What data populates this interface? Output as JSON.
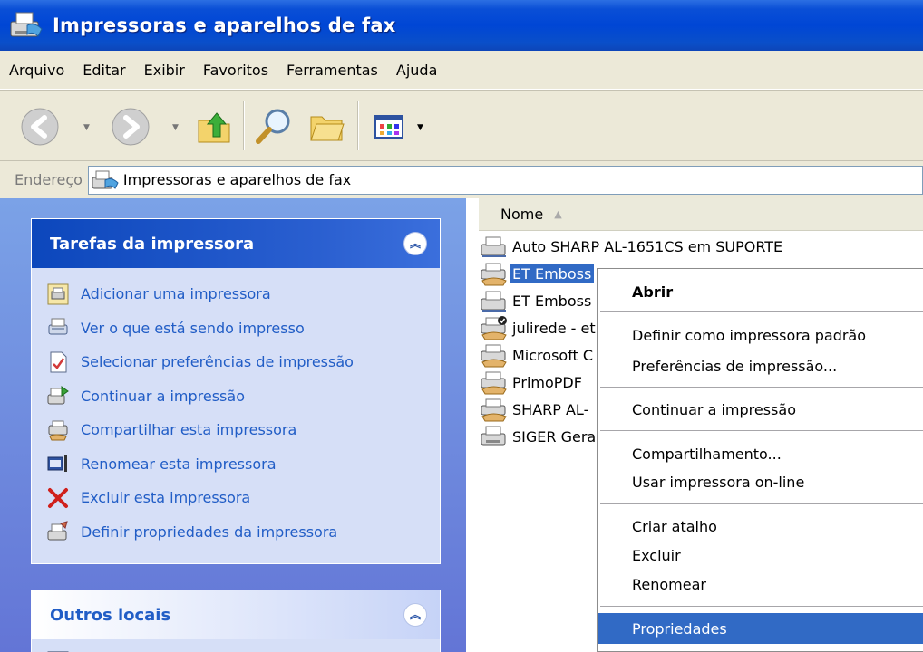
{
  "window": {
    "title": "Impressoras e aparelhos de fax"
  },
  "menu": [
    "Arquivo",
    "Editar",
    "Exibir",
    "Favoritos",
    "Ferramentas",
    "Ajuda"
  ],
  "address": {
    "label": "Endereço",
    "value": "Impressoras e aparelhos de fax"
  },
  "tasks_panel": {
    "title": "Tarefas da impressora",
    "items": [
      "Adicionar uma impressora",
      "Ver o que está sendo impresso",
      "Selecionar preferências de impressão",
      "Continuar a impressão",
      "Compartilhar esta impressora",
      "Renomear esta impressora",
      "Excluir esta impressora",
      "Definir propriedades da impressora"
    ]
  },
  "other_panel": {
    "title": "Outros locais"
  },
  "filelist": {
    "column_name": "Nome",
    "items": [
      "Auto SHARP AL-1651CS em SUPORTE",
      "ET Emboss",
      "ET Emboss",
      "julirede - et",
      "Microsoft C",
      "PrimoPDF",
      "SHARP AL-",
      "SIGER Gera"
    ],
    "selected_index": 1
  },
  "context_menu": {
    "open": "Abrir",
    "set_default": "Definir como impressora padrão",
    "preferences": "Preferências de impressão...",
    "resume": "Continuar a impressão",
    "sharing": "Compartilhamento...",
    "use_online": "Usar impressora on-line",
    "create_shortcut": "Criar atalho",
    "delete": "Excluir",
    "rename": "Renomear",
    "properties": "Propriedades"
  },
  "colors": {
    "titlebar": "#0046d5",
    "selection": "#316ac5",
    "task_link": "#215dc6",
    "task_pane": "#7ba2e7"
  }
}
